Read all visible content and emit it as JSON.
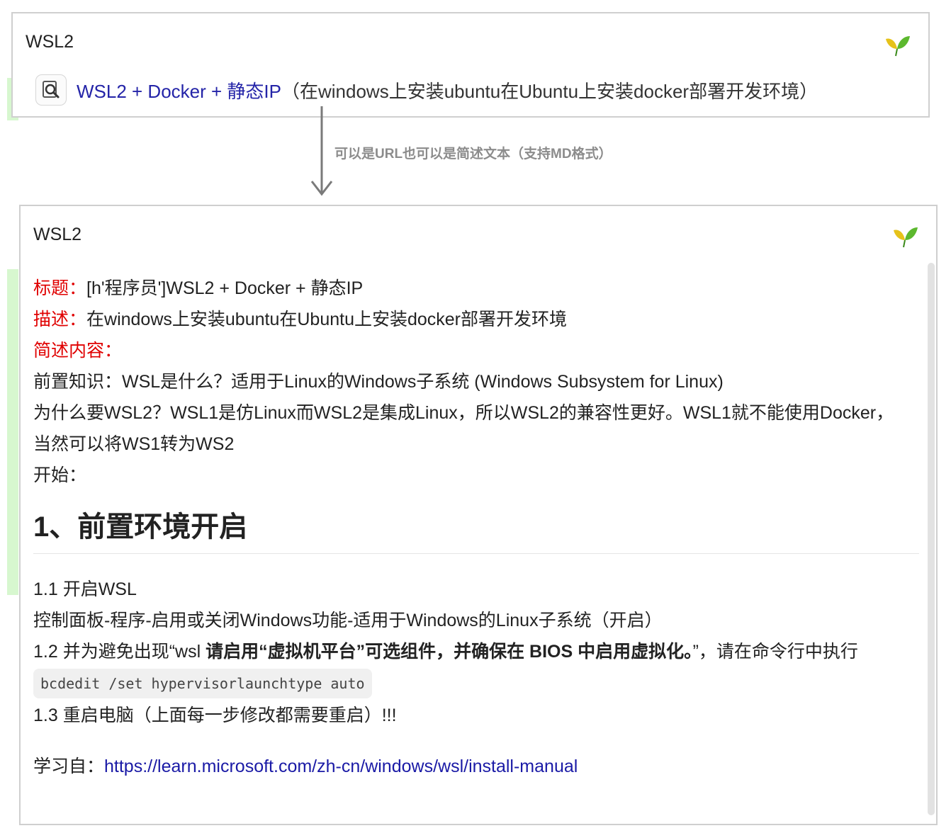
{
  "top_card": {
    "title": "WSL2",
    "result_title": "WSL2 + Docker + 静态IP",
    "result_desc": "（在windows上安装ubuntu在Ubuntu上安装docker部署开发环境）"
  },
  "arrow_note": "可以是URL也可以是简述文本（支持MD格式）",
  "bottom_card": {
    "title": "WSL2",
    "title_label": "标题：",
    "title_value": "[h'程序员']WSL2 + Docker + 静态IP",
    "desc_label": "描述：",
    "desc_value": "在windows上安装ubuntu在Ubuntu上安装docker部署开发环境",
    "summary_label": "简述内容：",
    "line_1": "前置知识：WSL是什么？适用于Linux的Windows子系统 (Windows Subsystem for Linux)",
    "line_2": "为什么要WSL2？WSL1是仿Linux而WSL2是集成Linux，所以WSL2的兼容性更好。WSL1就不能使用Docker，",
    "line_3": "当然可以将WS1转为WS2",
    "line_4": "开始：",
    "heading_1": "1、前置环境开启",
    "step_1_1": "1.1 开启WSL",
    "step_1_1_detail": "控制面板-程序-启用或关闭Windows功能-适用于Windows的Linux子系统（开启）",
    "step_1_2_prefix": "1.2 并为避免出现“wsl ",
    "step_1_2_bold": "请启用“虚拟机平台”可选组件，并确保在 BIOS 中启用虚拟化。",
    "step_1_2_suffix": "”，请在命令行中执行",
    "code": "bcdedit /set hypervisorlaunchtype auto",
    "step_1_3": "1.3 重启电脑（上面每一步修改都需要重启）!!!",
    "learn_label": "学习自：",
    "learn_link": "https://learn.microsoft.com/zh-cn/windows/wsl/install-manual"
  },
  "icons": [
    "leaf-icon",
    "search-icon",
    "down-arrow-icon"
  ]
}
